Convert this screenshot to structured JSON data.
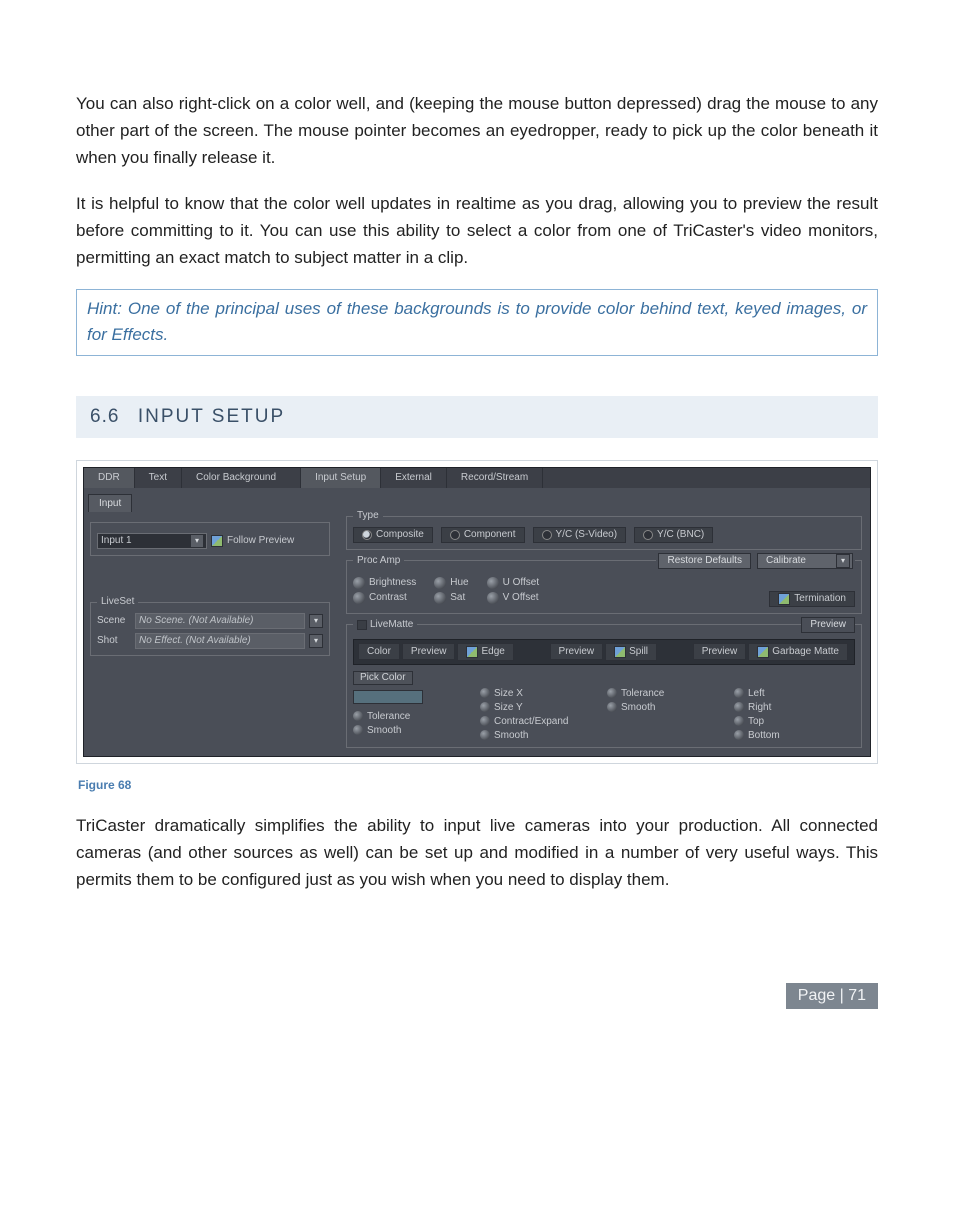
{
  "body": {
    "p1": "You can also right-click on a color well, and (keeping the mouse button depressed) drag the mouse to any other part of the screen.  The mouse pointer becomes an eyedropper, ready to pick up the color beneath it when you finally release it.",
    "p2": "It is helpful to know that the color well updates in realtime as you drag, allowing you to preview the result before committing to it.  You can use this ability to select a color from one of TriCaster's video monitors, permitting an exact match to subject matter in a clip.",
    "hint": "Hint: One of the principal uses of these backgrounds is to provide color behind text, keyed images, or for Effects.",
    "p3": "TriCaster dramatically simplifies the ability to input live cameras into your production. All connected cameras (and other sources as well) can be set up and modified in a number of very useful ways.  This permits them to be configured just as you wish when you need to display them."
  },
  "section": {
    "num": "6.6",
    "title": "INPUT SETUP"
  },
  "figure_caption": "Figure 68",
  "page_footer": "Page | 71",
  "app": {
    "top_tabs": [
      "DDR",
      "Text",
      "Color Background",
      "Input Setup",
      "External",
      "Record/Stream"
    ],
    "left": {
      "sub_tab": "Input",
      "input_select": "Input 1",
      "follow_preview": "Follow Preview",
      "liveset": {
        "title": "LiveSet",
        "scene_label": "Scene",
        "scene_value": "No Scene. (Not Available)",
        "shot_label": "Shot",
        "shot_value": "No Effect. (Not Available)"
      }
    },
    "right": {
      "type": {
        "title": "Type",
        "options": [
          "Composite",
          "Component",
          "Y/C (S-Video)",
          "Y/C (BNC)"
        ]
      },
      "procamp": {
        "title": "Proc Amp",
        "restore": "Restore Defaults",
        "calibrate": "Calibrate",
        "knobs_left": [
          "Brightness",
          "Contrast"
        ],
        "knobs_mid": [
          "Hue",
          "Sat"
        ],
        "knobs_right": [
          "U Offset",
          "V Offset"
        ],
        "termination": "Termination"
      },
      "livematte": {
        "title": "LiveMatte",
        "preview_btn": "Preview",
        "strip": {
          "color": "Color",
          "preview": "Preview",
          "edge": "Edge",
          "spill": "Spill",
          "garbage": "Garbage Matte"
        },
        "col1": {
          "pick": "Pick Color",
          "tolerance": "Tolerance",
          "smooth": "Smooth"
        },
        "col2": {
          "sizex": "Size X",
          "sizey": "Size Y",
          "contract": "Contract/Expand",
          "smooth": "Smooth"
        },
        "col3": {
          "tolerance": "Tolerance",
          "smooth": "Smooth"
        },
        "col4": {
          "left": "Left",
          "right": "Right",
          "top": "Top",
          "bottom": "Bottom"
        }
      }
    }
  }
}
